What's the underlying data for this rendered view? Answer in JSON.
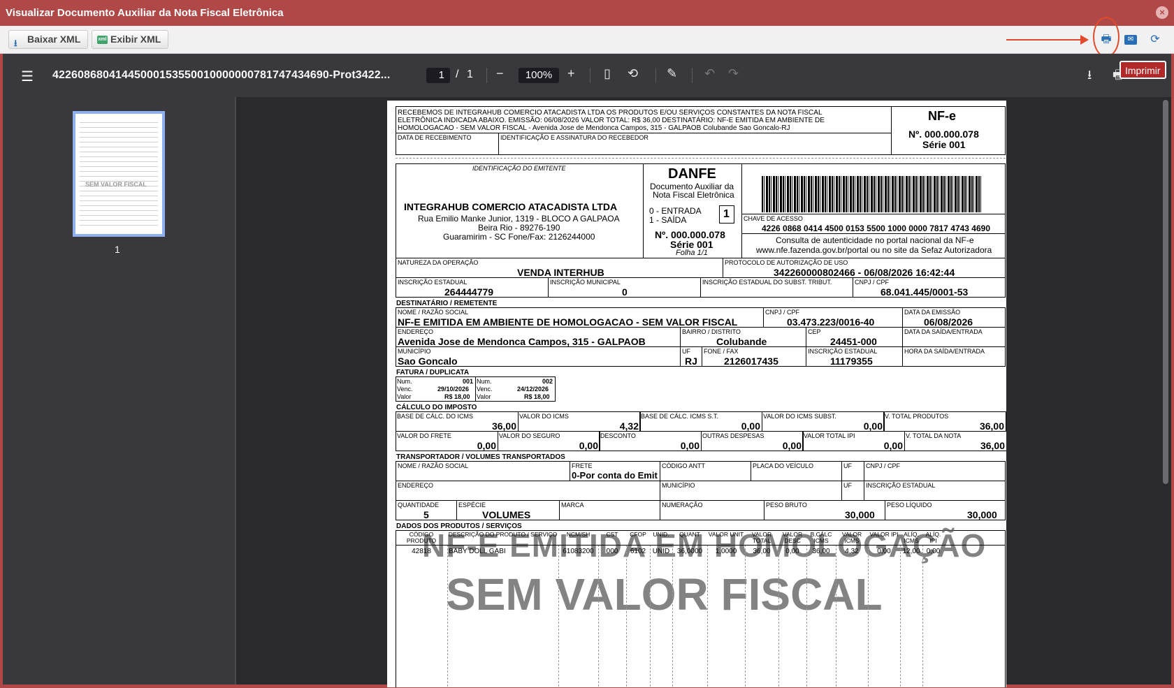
{
  "window": {
    "title": "Visualizar Documento Auxiliar da Nota Fiscal Eletrônica"
  },
  "toolbar": {
    "download_xml": "Baixar XML",
    "show_xml": "Exibir XML",
    "tooltip": "Imprimir"
  },
  "viewer": {
    "filename": "42260868041445000153550010000000781747434690-Prot3422...",
    "page_current": "1",
    "page_sep": "/",
    "page_total": "1",
    "zoom": "100%",
    "thumb_label": "1"
  },
  "doc": {
    "receipt_text1": "RECEBEMOS DE INTEGRAHUB COMERCIO ATACADISTA LTDA OS PRODUTOS E/OU SERVIÇOS CONSTANTES DA NOTA FISCAL",
    "receipt_text2": "ELETRÔNICA INDICADA ABAIXO. EMISSÃO: 06/08/2026 VALOR TOTAL: R$ 36,00 DESTINATÁRIO: NF-E EMITIDA EM AMBIENTE DE",
    "receipt_text3": "HOMOLOGACAO - SEM VALOR FISCAL - Avenida Jose de Mendonca Campos, 315 - GALPAOB Colubande Sao Goncalo-RJ",
    "data_recebimento": "DATA DE RECEBIMENTO",
    "identificacao": "IDENTIFICAÇÃO E ASSINATURA DO RECEBEDOR",
    "nfe": "NF-e",
    "numero": "Nº. 000.000.078",
    "serie": "Série 001",
    "ident_emitente": "IDENTIFICAÇÃO DO EMITENTE",
    "emitente_nome": "INTEGRAHUB COMERCIO ATACADISTA LTDA",
    "emitente_end1": "Rua Emilio Manke Junior, 1319 - BLOCO A GALPAOA",
    "emitente_end2": "Beira Rio - 89276-190",
    "emitente_end3": "Guaramirim - SC Fone/Fax: 2126244000",
    "danfe": "DANFE",
    "danfe_sub1": "Documento Auxiliar da",
    "danfe_sub2": "Nota Fiscal Eletrônica",
    "entrada": "0 - ENTRADA",
    "saida": "1 - SAÍDA",
    "tipo": "1",
    "danfe_num": "Nº. 000.000.078",
    "danfe_serie": "Série 001",
    "folha": "Folha 1/1",
    "chave_lbl": "CHAVE DE ACESSO",
    "chave": "4226 0868 0414 4500 0153 5500 1000 0000 7817 4743 4690",
    "consulta1": "Consulta de autenticidade no portal nacional da NF-e",
    "consulta2": "www.nfe.fazenda.gov.br/portal ou no site da Sefaz Autorizadora",
    "natureza_lbl": "NATUREZA DA OPERAÇÃO",
    "natureza": "VENDA INTERHUB",
    "protocolo_lbl": "PROTOCOLO DE AUTORIZAÇÃO DE USO",
    "protocolo": "342260000802466  -  06/08/2026 16:42:44",
    "ie_lbl": "INSCRIÇÃO ESTADUAL",
    "ie": "264444779",
    "im_lbl": "INSCRIÇÃO MUNICIPAL",
    "im": "0",
    "iest_lbl": "INSCRIÇÃO ESTADUAL DO SUBST. TRIBUT.",
    "cnpj_lbl": "CNPJ / CPF",
    "cnpj": "68.041.445/0001-53",
    "dest_title": "DESTINATÁRIO / REMETENTE",
    "razao_lbl": "NOME / RAZÃO SOCIAL",
    "razao": "NF-E EMITIDA EM AMBIENTE DE HOMOLOGACAO - SEM VALOR FISCAL",
    "dest_cnpj_lbl": "CNPJ / CPF",
    "dest_cnpj": "03.473.223/0016-40",
    "emissao_lbl": "DATA DA EMISSÃO",
    "emissao": "06/08/2026",
    "endereco_lbl": "ENDEREÇO",
    "endereco": "Avenida Jose de Mendonca Campos, 315 - GALPAOB",
    "bairro_lbl": "BAIRRO / DISTRITO",
    "bairro": "Colubande",
    "cep_lbl": "CEP",
    "cep": "24451-000",
    "saida_lbl": "DATA DA SAÍDA/ENTRADA",
    "municipio_lbl": "MUNICÍPIO",
    "municipio": "Sao Goncalo",
    "uf_lbl": "UF",
    "uf": "RJ",
    "fone_lbl": "FONE / FAX",
    "fone": "2126017435",
    "dest_ie_lbl": "INSCRIÇÃO ESTADUAL",
    "dest_ie": "11179355",
    "hora_lbl": "HORA DA SAÍDA/ENTRADA",
    "fatura_title": "FATURA / DUPLICATA",
    "dup1": {
      "num_lbl": "Num.",
      "num": "001",
      "venc_lbl": "Venc.",
      "venc": "29/10/2026",
      "valor_lbl": "Valor",
      "valor": "R$ 18,00"
    },
    "dup2": {
      "num_lbl": "Num.",
      "num": "002",
      "venc_lbl": "Venc.",
      "venc": "24/12/2026",
      "valor_lbl": "Valor",
      "valor": "R$ 18,00"
    },
    "calc_title": "CÁLCULO DO IMPOSTO",
    "calc_row1": [
      {
        "lbl": "BASE DE CÁLC. DO ICMS",
        "val": "36,00"
      },
      {
        "lbl": "VALOR DO ICMS",
        "val": "4,32"
      },
      {
        "lbl": "BASE DE CÁLC. ICMS S.T.",
        "val": "0,00"
      },
      {
        "lbl": "VALOR DO ICMS SUBST.",
        "val": "0,00"
      },
      {
        "lbl": "V. TOTAL PRODUTOS",
        "val": "36,00"
      }
    ],
    "calc_row2": [
      {
        "lbl": "VALOR DO FRETE",
        "val": "0,00"
      },
      {
        "lbl": "VALOR DO SEGURO",
        "val": "0,00"
      },
      {
        "lbl": "DESCONTO",
        "val": "0,00"
      },
      {
        "lbl": "OUTRAS DESPESAS",
        "val": "0,00"
      },
      {
        "lbl": "VALOR TOTAL IPI",
        "val": "0,00"
      },
      {
        "lbl": "V. TOTAL DA NOTA",
        "val": "36,00"
      }
    ],
    "transp_title": "TRANSPORTADOR / VOLUMES TRANSPORTADOS",
    "transp_razao_lbl": "NOME / RAZÃO SOCIAL",
    "frete_lbl": "FRETE",
    "frete": "0-Por conta do Emit",
    "antt_lbl": "CÓDIGO ANTT",
    "placa_lbl": "PLACA DO VEÍCULO",
    "t_uf_lbl": "UF",
    "t_cnpj_lbl": "CNPJ / CPF",
    "t_end_lbl": "ENDEREÇO",
    "t_mun_lbl": "MUNICÍPIO",
    "t_uf2_lbl": "UF",
    "t_ie_lbl": "INSCRIÇÃO ESTADUAL",
    "qtd_lbl": "QUANTIDADE",
    "qtd": "5",
    "especie_lbl": "ESPÉCIE",
    "especie": "VOLUMES",
    "marca_lbl": "MARCA",
    "numeracao_lbl": "NUMERAÇÃO",
    "pbruto_lbl": "PESO BRUTO",
    "pbruto": "30,000",
    "pliq_lbl": "PESO LÍQUIDO",
    "pliq": "30,000",
    "prod_title": "DADOS DOS PRODUTOS / SERVIÇOS",
    "prod_headers": [
      "CÓDIGO PRODUTO",
      "DESCRIÇÃO DO PRODUTO / SERVIÇO",
      "NCM/SH",
      "CST",
      "CFOP",
      "UNID.",
      "QUANT",
      "VALOR UNIT",
      "VALOR TOTAL",
      "VALOR DESC",
      "B.CÁLC ICMS",
      "VALOR ICMS",
      "VALOR IPI",
      "ALÍQ. ICMS",
      "ALÍQ. IPI"
    ],
    "prod_row": [
      "42818",
      "BABY DOLL GABI",
      "61083200",
      "000",
      "6102",
      "UNID",
      "36,0000",
      "1,0000",
      "36,00",
      "0,00",
      "36,00",
      "4,32",
      "0,00",
      "12,00",
      "0,00"
    ],
    "watermark1": "NF-E EMITIDA EM HOMOLOGAÇÃO",
    "watermark2": "SEM VALOR FISCAL",
    "thumb_mark": "SEM VALOR FISCAL"
  }
}
